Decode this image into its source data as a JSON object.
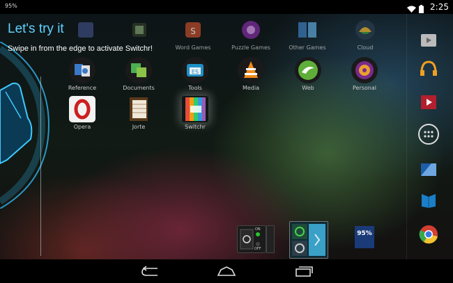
{
  "status_bar": {
    "battery_text": "95%",
    "time": "2:25",
    "icons": [
      "wifi-icon",
      "battery-icon"
    ]
  },
  "overlay": {
    "title": "Let's try it",
    "subtitle": "Swipe in from the edge to activate Switchr!"
  },
  "apps": {
    "row1": [
      {
        "label": "Word Games"
      },
      {
        "label": "Puzzle Games"
      },
      {
        "label": "Other Games"
      },
      {
        "label": "Cloud"
      }
    ],
    "row2": [
      {
        "label": "Reference"
      },
      {
        "label": "Documents"
      },
      {
        "label": "Tools"
      },
      {
        "label": "Media"
      },
      {
        "label": "Web"
      },
      {
        "label": "Personal"
      }
    ],
    "row3": [
      {
        "label": "Opera"
      },
      {
        "label": "Jorte"
      },
      {
        "label": "Switchr"
      }
    ]
  },
  "widgets": {
    "toggle_on": "ON",
    "toggle_off": "OFF",
    "battery_widget": "95%"
  },
  "dock": [
    "play-store-icon",
    "play-music-icon",
    "play-movies-icon",
    "app-drawer-icon",
    "files-icon",
    "play-books-icon",
    "chrome-icon"
  ],
  "colors": {
    "accent": "#5fd3ff",
    "opera_red": "#cc1f1f"
  }
}
